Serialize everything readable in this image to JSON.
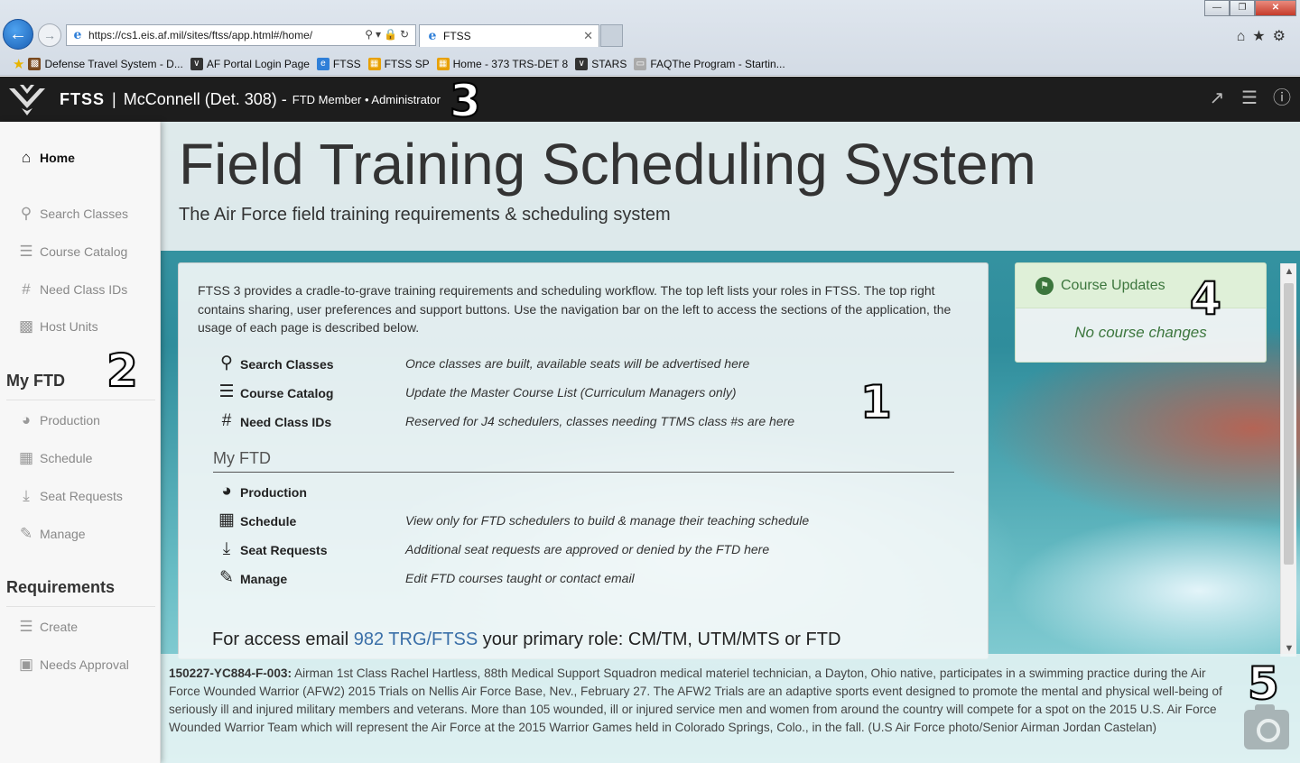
{
  "browser": {
    "url": "https://cs1.eis.af.mil/sites/ftss/app.html#/home/",
    "tab_title": "FTSS",
    "favorites": [
      "Defense Travel System - D...",
      "AF Portal Login Page",
      "FTSS",
      "FTSS SP",
      "Home - 373 TRS-DET 8",
      "STARS",
      "FAQThe Program - Startin..."
    ]
  },
  "header": {
    "app_name": "FTSS",
    "separator": "|",
    "unit": "McConnell (Det. 308) -",
    "roles": "FTD Member • Administrator",
    "markers": {
      "one": "1",
      "two": "2",
      "three": "3",
      "four": "4",
      "five": "5"
    }
  },
  "sidebar": {
    "home": "Home",
    "search_classes": "Search Classes",
    "course_catalog": "Course Catalog",
    "need_class_ids": "Need Class IDs",
    "host_units": "Host Units",
    "my_ftd_header": "My FTD",
    "production": "Production",
    "schedule": "Schedule",
    "seat_requests": "Seat Requests",
    "manage": "Manage",
    "requirements_header": "Requirements",
    "create": "Create",
    "needs_approval": "Needs Approval"
  },
  "hero": {
    "title": "Field Training Scheduling System",
    "subtitle": "The Air Force field training requirements & scheduling system"
  },
  "intro": "FTSS 3 provides a cradle-to-grave training requirements and scheduling workflow. The top left lists your roles in FTSS. The top right contains sharing, user preferences and support buttons. Use the navigation bar on the left to access the sections of the application, the usage of each page is described below.",
  "rows": {
    "search_classes": {
      "label": "Search Classes",
      "desc": "Once classes are built, available seats will be advertised here"
    },
    "course_catalog": {
      "label": "Course Catalog",
      "desc": "Update the Master Course List (Curriculum Managers only)"
    },
    "need_class_ids": {
      "label": "Need Class IDs",
      "desc": "Reserved for J4 schedulers, classes needing TTMS class #s are here"
    },
    "production": {
      "label": "Production",
      "desc": ""
    },
    "schedule": {
      "label": "Schedule",
      "desc": "View only for FTD schedulers to build & manage their teaching schedule"
    },
    "seat_requests": {
      "label": "Seat Requests",
      "desc": "Additional seat requests are approved or denied by the FTD here"
    },
    "manage": {
      "label": "Manage",
      "desc": "Edit FTD courses taught or contact email"
    }
  },
  "my_ftd_section": "My FTD",
  "access": {
    "prefix": "For access email",
    "link": "982 TRG/FTSS",
    "suffix": "your primary role: CM/TM, UTM/MTS or FTD"
  },
  "updates": {
    "title": "Course Updates",
    "body": "No course changes"
  },
  "caption": {
    "id": "150227-YC884-F-003:",
    "text": "Airman 1st Class Rachel Hartless, 88th Medical Support Squadron medical materiel technician, a Dayton, Ohio native, participates in a swimming practice during the Air Force Wounded Warrior (AFW2) 2015 Trials on Nellis Air Force Base, Nev., February 27. The AFW2 Trials are an adaptive sports event designed to promote the mental and physical well-being of seriously ill and injured military members and veterans. More than 105 wounded, ill or injured service men and women from around the country will compete for a spot on the 2015 U.S. Air Force Wounded Warrior Team which will represent the Air Force at the 2015 Warrior Games held in Colorado Springs, Colo., in the fall. (U.S Air Force photo/Senior Airman Jordan Castelan)"
  },
  "colors": {
    "header_bg": "#1d1d1d",
    "updates_green": "#3c763d",
    "link_blue": "#3a6fa8"
  }
}
